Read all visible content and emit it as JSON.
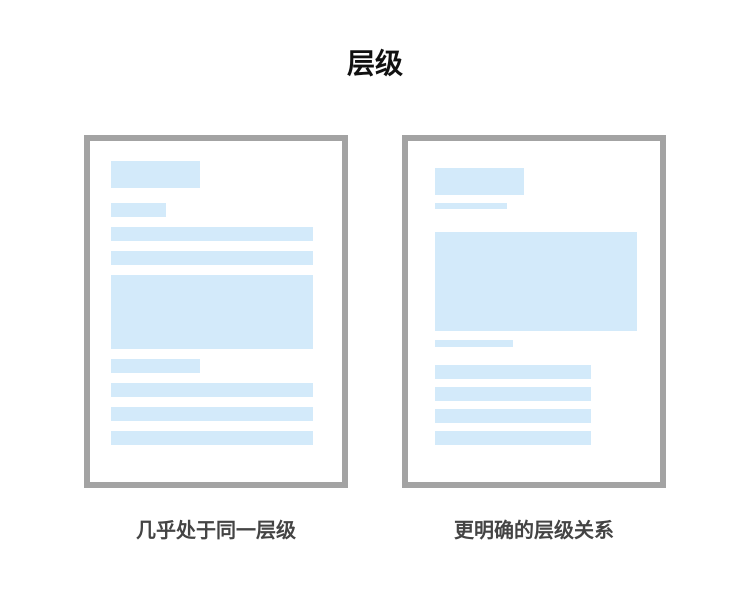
{
  "title": "层级",
  "panels": [
    {
      "caption": "几乎处于同一层级"
    },
    {
      "caption": "更明确的层级关系"
    }
  ],
  "colors": {
    "frame_border": "#a3a3a3",
    "placeholder_block": "#d3eafa",
    "title_text": "#111111",
    "caption_text": "#444444"
  }
}
